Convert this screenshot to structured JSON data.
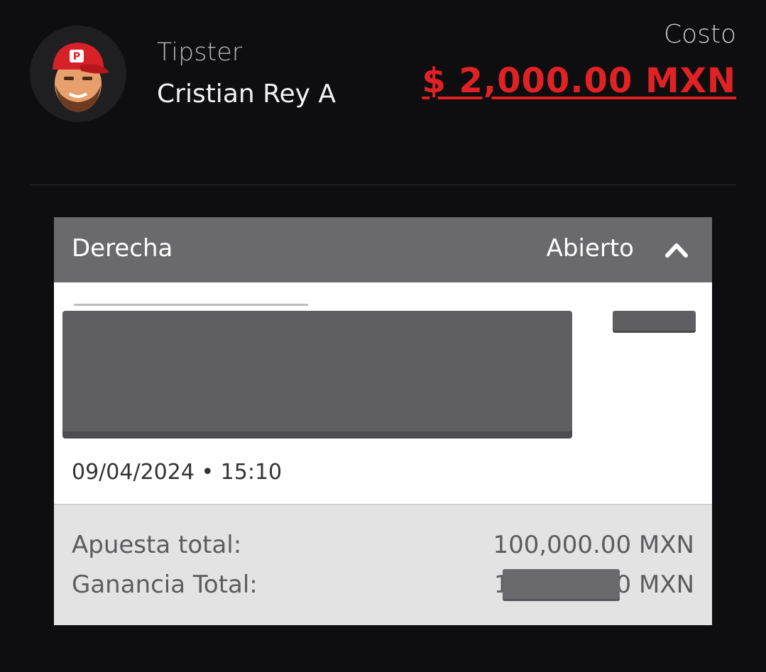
{
  "tipster": {
    "label": "Tipster",
    "name": "Cristian Rey A"
  },
  "cost": {
    "label": "Costo",
    "value": "$ 2,000.00 MXN",
    "color": "#e02225"
  },
  "bet": {
    "title": "Derecha",
    "status": "Abierto",
    "date": "09/04/2024 • 15:10",
    "total_stake_label": "Apuesta total:",
    "total_stake_value": "100,000.00 MXN",
    "total_winnings_label": "Ganancia Total:",
    "total_winnings_value": "1",
    "total_winnings_suffix": "0 MXN"
  },
  "icons": {
    "avatar": "cartoon-avatar-red-cap",
    "toggle": "chevron-up-icon"
  }
}
